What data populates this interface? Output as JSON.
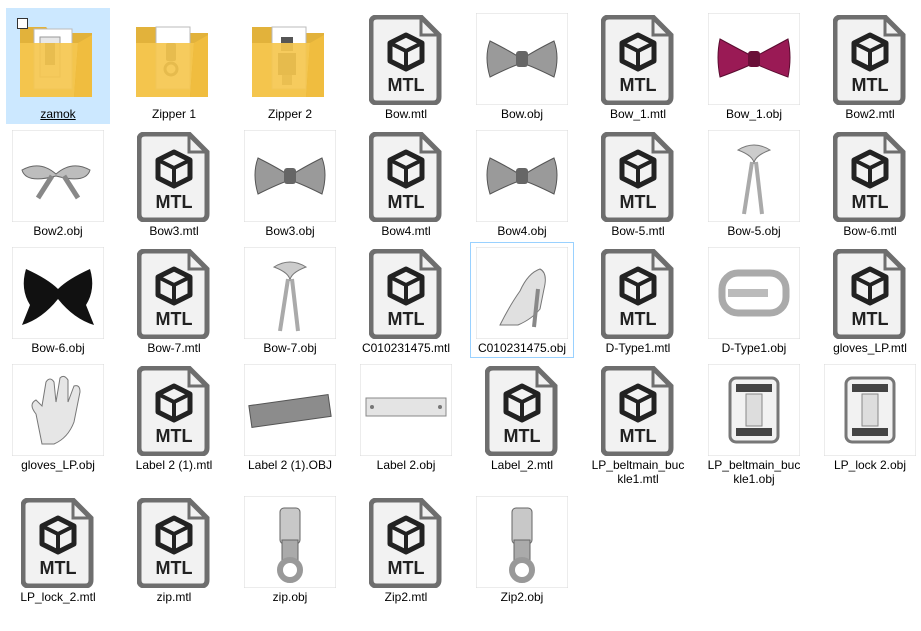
{
  "files": [
    {
      "name": "zamok",
      "type": "folder"
    },
    {
      "name": "Zipper 1",
      "type": "folder"
    },
    {
      "name": "Zipper 2",
      "type": "folder"
    },
    {
      "name": "Bow.mtl",
      "type": "mtl"
    },
    {
      "name": "Bow.obj",
      "type": "bow-grey"
    },
    {
      "name": "Bow_1.mtl",
      "type": "mtl"
    },
    {
      "name": "Bow_1.obj",
      "type": "bow-magenta"
    },
    {
      "name": "Bow2.mtl",
      "type": "mtl"
    },
    {
      "name": "Bow2.obj",
      "type": "bow-flat"
    },
    {
      "name": "Bow3.mtl",
      "type": "mtl"
    },
    {
      "name": "Bow3.obj",
      "type": "bow-grey"
    },
    {
      "name": "Bow4.mtl",
      "type": "mtl"
    },
    {
      "name": "Bow4.obj",
      "type": "bow-grey"
    },
    {
      "name": "Bow-5.mtl",
      "type": "mtl"
    },
    {
      "name": "Bow-5.obj",
      "type": "ribbon"
    },
    {
      "name": "Bow-6.mtl",
      "type": "mtl"
    },
    {
      "name": "Bow-6.obj",
      "type": "bow-black"
    },
    {
      "name": "Bow-7.mtl",
      "type": "mtl"
    },
    {
      "name": "Bow-7.obj",
      "type": "ribbon"
    },
    {
      "name": "C010231475.mtl",
      "type": "mtl"
    },
    {
      "name": "C010231475.obj",
      "type": "shoe"
    },
    {
      "name": "D-Type1.mtl",
      "type": "mtl"
    },
    {
      "name": "D-Type1.obj",
      "type": "buckle"
    },
    {
      "name": "gloves_LP.mtl",
      "type": "mtl"
    },
    {
      "name": "gloves_LP.obj",
      "type": "glove"
    },
    {
      "name": "Label 2 (1).mtl",
      "type": "mtl"
    },
    {
      "name": "Label 2 (1).OBJ",
      "type": "label-plate"
    },
    {
      "name": "Label 2.obj",
      "type": "label-plate-light"
    },
    {
      "name": "Label_2.mtl",
      "type": "mtl"
    },
    {
      "name": "LP_beltmain_buckle1.mtl",
      "type": "mtl"
    },
    {
      "name": "LP_beltmain_buckle1.obj",
      "type": "clip"
    },
    {
      "name": "LP_lock 2.obj",
      "type": "clip"
    },
    {
      "name": "LP_lock_2.mtl",
      "type": "mtl"
    },
    {
      "name": "zip.mtl",
      "type": "mtl"
    },
    {
      "name": "zip.obj",
      "type": "zipper"
    },
    {
      "name": "Zip2.mtl",
      "type": "mtl"
    },
    {
      "name": "Zip2.obj",
      "type": "zipper"
    }
  ],
  "mtl_badge": "MTL",
  "colors": {
    "selection": "#cce8ff",
    "focus": "#99d1ff",
    "folder": "#f5c74f",
    "icon_border": "#6e6e6e",
    "magenta": "#9a1a55"
  },
  "selected_item": "zamok",
  "focused_item": "C010231475.obj"
}
